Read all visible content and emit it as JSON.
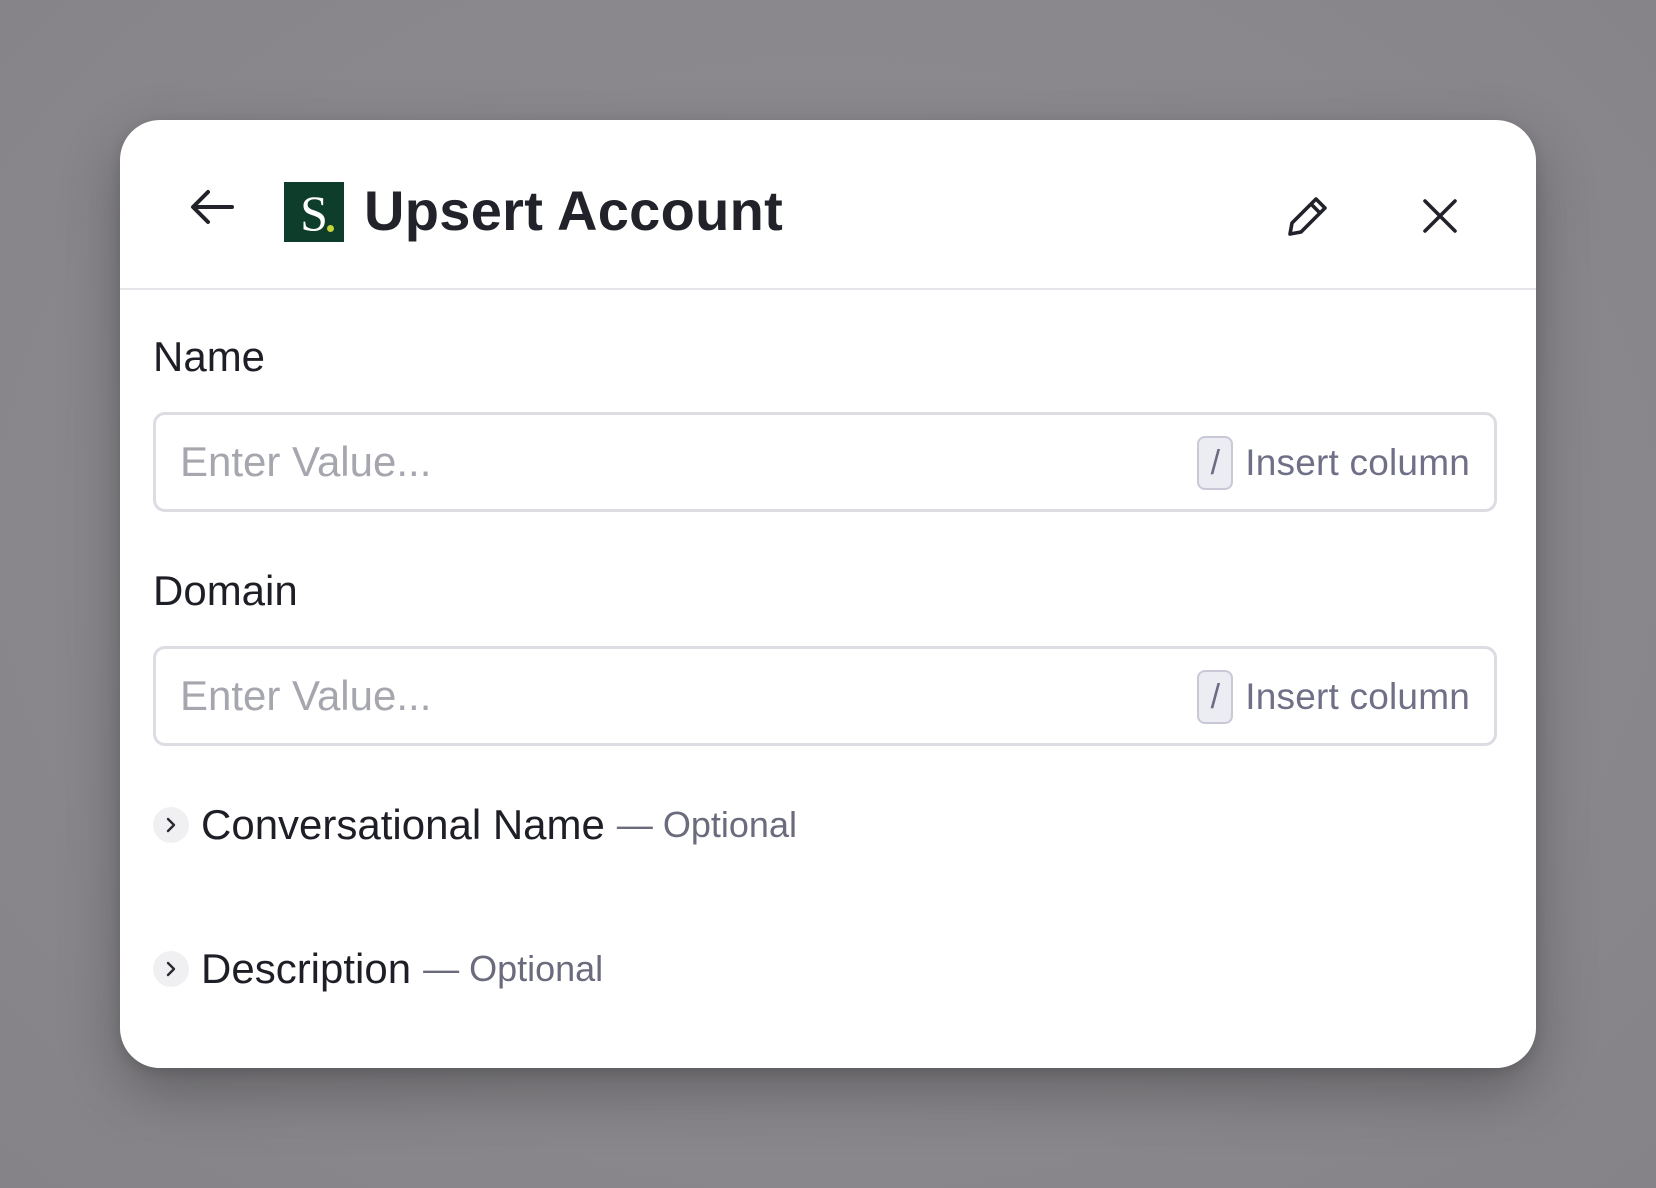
{
  "colors": {
    "backdrop": "#8b898d",
    "modal_background": "#ffffff",
    "logo_background": "#0e3d2c",
    "logo_dot": "#c6d63a",
    "title_text": "#22232a",
    "placeholder_text": "#a6a7ae",
    "insert_column_text": "#6f7088",
    "input_border": "#dcdce3"
  },
  "header": {
    "back_icon": "arrow-left-icon",
    "logo_letter": "S",
    "title": "Upsert Account",
    "edit_icon": "pencil-icon",
    "close_icon": "close-icon"
  },
  "fields": [
    {
      "label": "Name",
      "placeholder": "Enter Value...",
      "insert_key": "/",
      "insert_label": "Insert column"
    },
    {
      "label": "Domain",
      "placeholder": "Enter Value...",
      "insert_key": "/",
      "insert_label": "Insert column"
    }
  ],
  "optional_fields": [
    {
      "title": "Conversational Name",
      "suffix": "— Optional",
      "icon": "chevron-right-icon"
    },
    {
      "title": "Description",
      "suffix": "— Optional",
      "icon": "chevron-right-icon"
    }
  ]
}
